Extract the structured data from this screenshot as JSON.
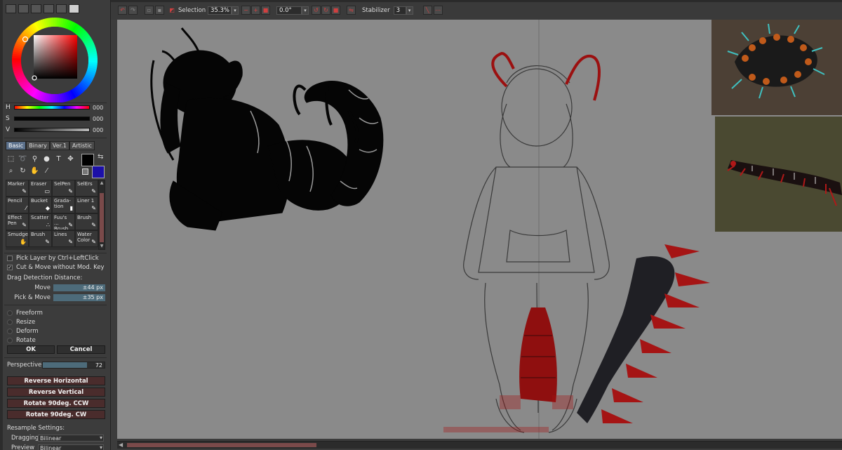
{
  "colors": {
    "accent_red": "#b03030",
    "panel_bg": "#3c3c3c",
    "canvas_bg": "#8a8a8a",
    "field_blue": "#4d6b7a",
    "secondary_swatch": "#1c10a8"
  },
  "left_panel": {
    "color_tabs": [
      "color-wheel-icon",
      "slider-icon",
      "palette-icon",
      "swatches-icon",
      "grid-icon",
      "scratchpad-icon"
    ],
    "hsv": [
      {
        "label": "H",
        "value": "000"
      },
      {
        "label": "S",
        "value": "000"
      },
      {
        "label": "V",
        "value": "000"
      }
    ],
    "tool_tabs": [
      "Basic",
      "Binary",
      "Ver.1",
      "Artistic"
    ],
    "tool_icons": [
      "select-icon",
      "lasso-icon",
      "magic-wand-icon",
      "hand-icon",
      "text-icon",
      "move-icon",
      "zoom-icon",
      "rotate-icon",
      "grab-icon",
      "eyedropper-icon"
    ],
    "brushes": [
      {
        "name": "Marker"
      },
      {
        "name": "Eraser"
      },
      {
        "name": "SelPen"
      },
      {
        "name": "SelErs"
      },
      {
        "name": "Pencil"
      },
      {
        "name": "Bucket"
      },
      {
        "name": "Grada-tion"
      },
      {
        "name": "Liner 1"
      },
      {
        "name": "Effect Pen"
      },
      {
        "name": "Scatter"
      },
      {
        "name": "Fuu's ... Brush"
      },
      {
        "name": "Brush"
      },
      {
        "name": "Smudge"
      },
      {
        "name": "Brush"
      },
      {
        "name": "Lines"
      },
      {
        "name": "Water Color"
      }
    ],
    "options": {
      "pick_layer": "Pick Layer by Ctrl+LeftClick",
      "cut_move": "Cut & Move without Mod. Key",
      "drag_detection": "Drag Detection Distance:",
      "move_label": "Move",
      "move_value": "±44 px",
      "pick_move_label": "Pick & Move",
      "pick_move_value": "±35 px"
    },
    "transform_modes": [
      "Freeform",
      "Resize",
      "Deform",
      "Rotate"
    ],
    "ok": "OK",
    "cancel": "Cancel",
    "perspective_label": "Perspective",
    "perspective_value": "72",
    "perspective_level": 0.72,
    "actions": [
      "Reverse Horizontal",
      "Reverse Vertical",
      "Rotate 90deg. CCW",
      "Rotate 90deg. CW"
    ],
    "resample_label": "Resample Settings:",
    "dragging_label": "Dragging",
    "dragging_value": "Bilinear",
    "preview_label": "Preview",
    "preview_value": "Bilinear"
  },
  "toolbar": {
    "selection_label": "Selection",
    "zoom": "35.3%",
    "angle": "0.0°",
    "stabilizer_label": "Stabilizer",
    "stabilizer_value": "3"
  }
}
